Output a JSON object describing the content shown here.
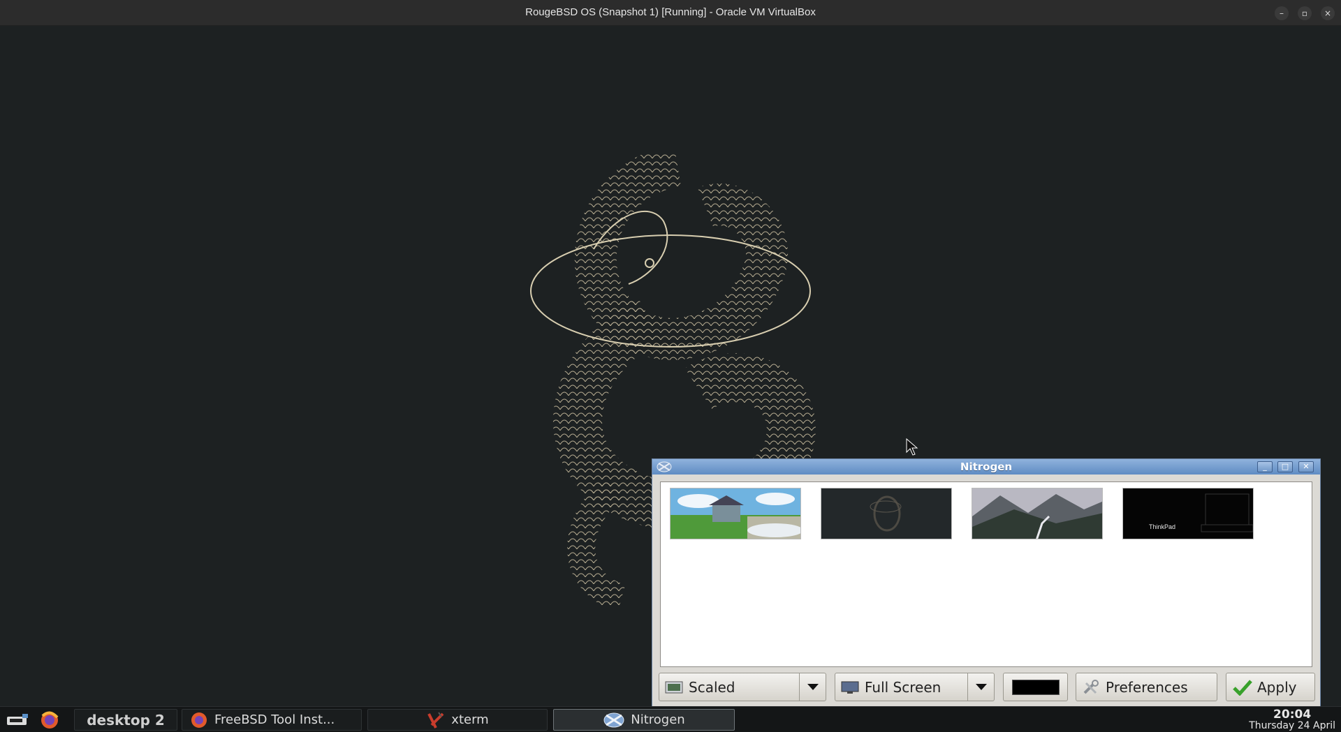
{
  "host": {
    "title": "RougeBSD OS (Snapshot 1) [Running] - Oracle VM VirtualBox",
    "minimize_glyph": "–",
    "restore_glyph": "▫",
    "close_glyph": "×"
  },
  "nitrogen": {
    "title": "Nitrogen",
    "buttons": {
      "minimize": "_",
      "maximize": "□",
      "close": "✕"
    },
    "thumbnails": [
      {
        "name": "landscape-grass-clouds"
      },
      {
        "name": "dragon-dark"
      },
      {
        "name": "mountains-road"
      },
      {
        "name": "thinkpad-black",
        "overlay_text": "ThinkPad"
      }
    ],
    "toolbar": {
      "mode_label": "Scaled",
      "screen_label": "Full Screen",
      "color_value": "#000000",
      "preferences_label": "Preferences",
      "apply_label": "Apply"
    }
  },
  "taskbar": {
    "desktop_label": "desktop 2",
    "tasks": [
      {
        "label": "FreeBSD Tool Inst..."
      },
      {
        "label": "xterm"
      },
      {
        "label": "Nitrogen"
      }
    ],
    "clock_time": "20:04",
    "clock_date": "Thursday 24 April"
  }
}
